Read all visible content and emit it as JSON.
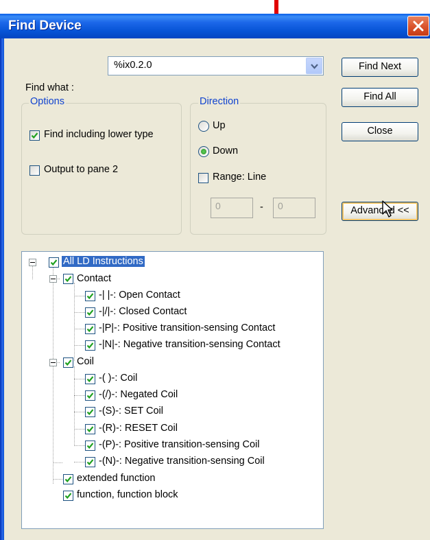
{
  "window": {
    "title": "Find Device"
  },
  "find": {
    "label": "Find what :",
    "value": "%ix0.2.0"
  },
  "buttons": {
    "find_next": "Find Next",
    "find_all": "Find All",
    "close": "Close",
    "advanced": "Advanced <<"
  },
  "options": {
    "title": "Options",
    "find_lower": {
      "label": "Find including lower type",
      "checked": true
    },
    "output_pane2": {
      "label": "Output to pane 2",
      "checked": false
    }
  },
  "direction": {
    "title": "Direction",
    "up": {
      "label": "Up",
      "selected": false
    },
    "down": {
      "label": "Down",
      "selected": true
    },
    "range": {
      "label": "Range: Line",
      "checked": false
    },
    "range_from": "0",
    "range_sep": "-",
    "range_to": "0"
  },
  "tree": {
    "root": "All LD Instructions",
    "contact": {
      "label": "Contact",
      "items": [
        "-| |-: Open Contact",
        "-|/|-: Closed Contact",
        "-|P|-: Positive transition-sensing Contact",
        "-|N|-: Negative transition-sensing Contact"
      ]
    },
    "coil": {
      "label": "Coil",
      "items": [
        "-( )-: Coil",
        "-(/)-: Negated Coil",
        "-(S)-: SET Coil",
        "-(R)-: RESET Coil",
        "-(P)-: Positive transition-sensing Coil",
        "-(N)-: Negative transition-sensing Coil"
      ]
    },
    "extended": "extended function",
    "function_block": "function, function block"
  },
  "colors": {
    "title_bar": "#0a5ee7",
    "dialog_bg": "#ece9d8",
    "group_title": "#1043cf",
    "selection": "#316ac5",
    "annotation_arrow": "#e00000",
    "close_button": "#d9522b"
  },
  "icons": [
    "red-down-arrow-icon",
    "close-icon",
    "dropdown-chevron-icon",
    "checkmark-icon",
    "expand-minus-icon",
    "mouse-cursor-icon"
  ]
}
